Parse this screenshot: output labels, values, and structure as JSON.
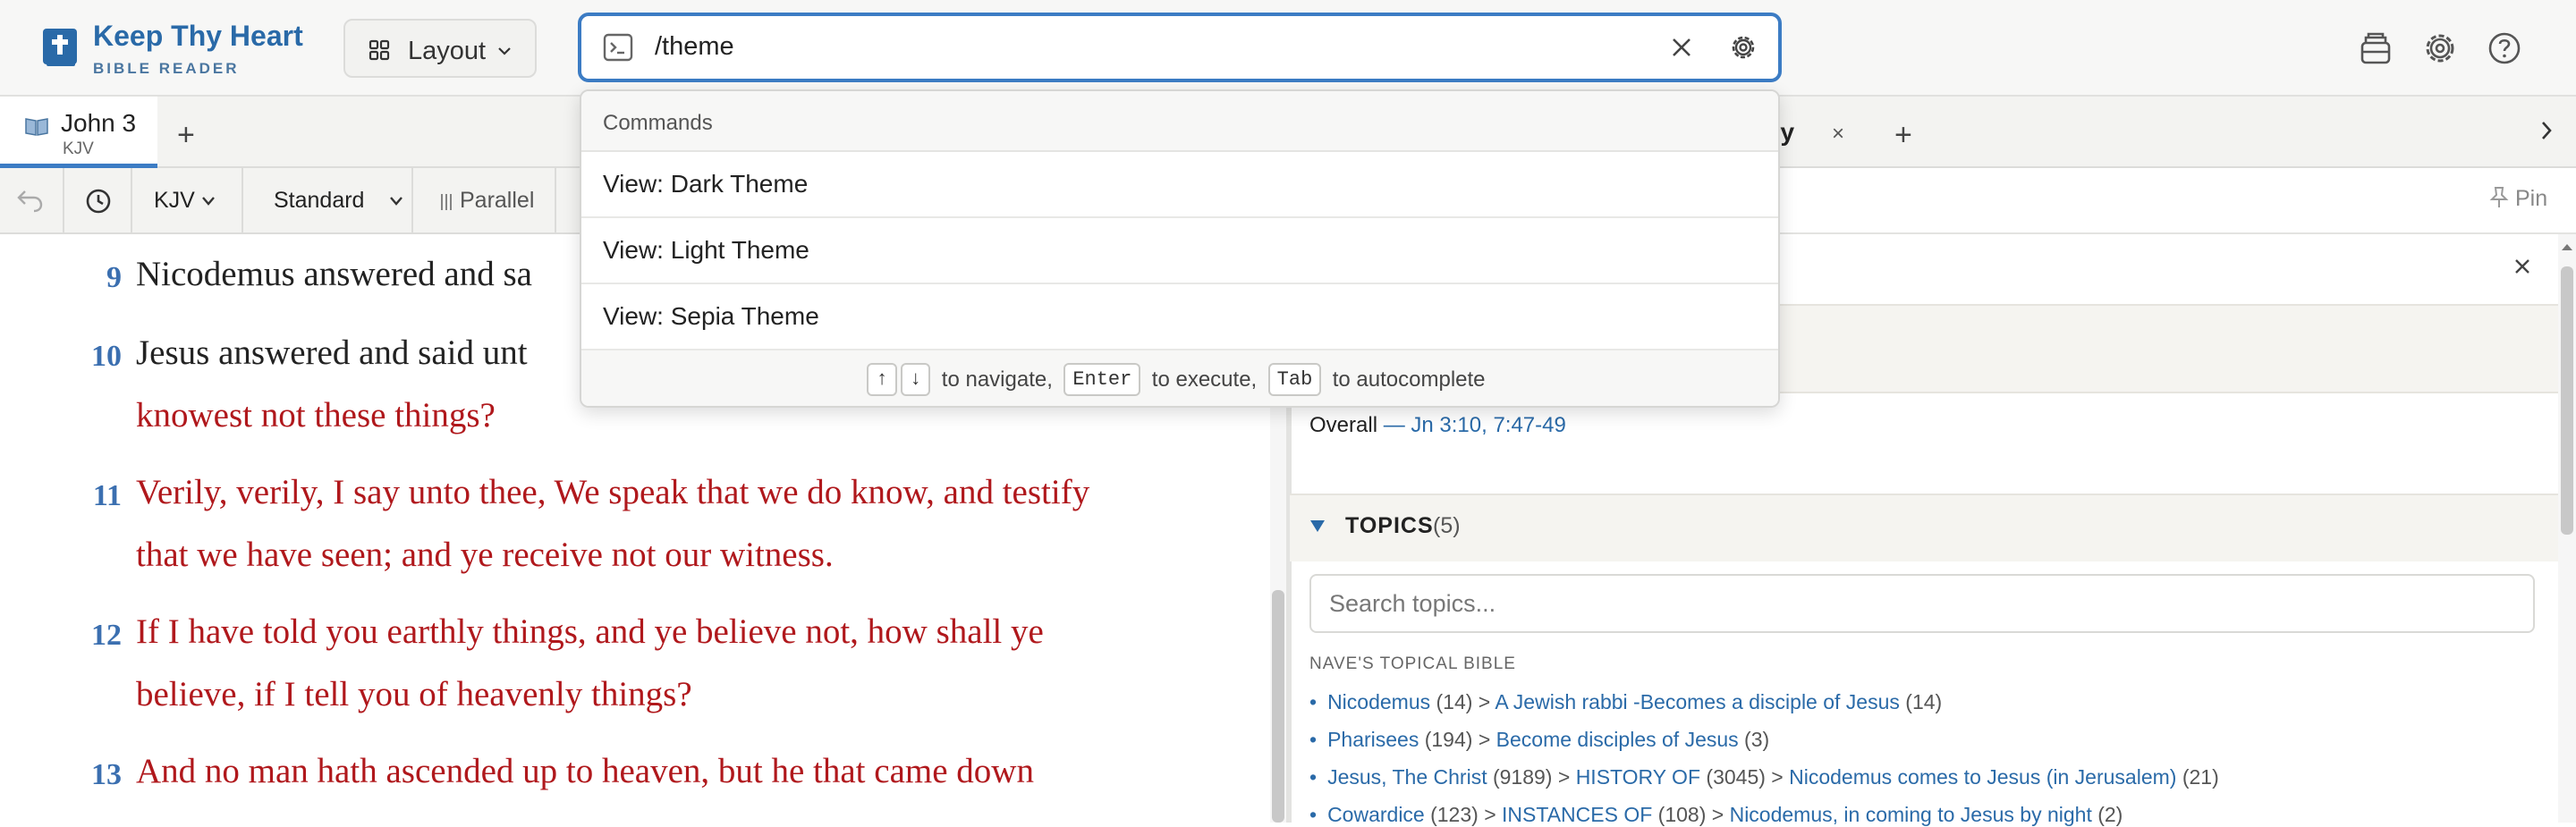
{
  "app": {
    "title": "Keep Thy Heart",
    "subtitle": "BIBLE READER"
  },
  "header": {
    "layout_label": "Layout",
    "command_value": "/theme"
  },
  "tabs": {
    "active": {
      "name": "John 3",
      "version": "KJV"
    },
    "add_label": "+",
    "right_tab_partial": "ary",
    "right_tab_close": "×"
  },
  "toolbar": {
    "version": "KJV",
    "mode": "Standard",
    "parallel": "Parallel",
    "pin": "Pin"
  },
  "bible": {
    "verses": [
      {
        "num": "9",
        "lines": [
          "Nicodemus answered and sa"
        ]
      },
      {
        "num": "10",
        "lines": [
          "Jesus answered and said unt",
          "knowest not these things?"
        ]
      },
      {
        "num": "11",
        "lines": [
          "Verily, verily, I say unto thee, We speak that we do know, and testify",
          "that we have seen; and ye receive not our witness."
        ]
      },
      {
        "num": "12",
        "lines": [
          "If I have told you earthly things, and ye believe not, how shall ye",
          "believe, if I tell you of heavenly things?"
        ]
      },
      {
        "num": "13",
        "lines": [
          "And no man hath ascended up to heaven, but he that came down"
        ]
      }
    ]
  },
  "panel": {
    "overall_label": "Overall",
    "overall_sep": " — ",
    "overall_refs": "Jn 3:10, 7:47-49",
    "topics_label": "TOPICS",
    "topics_count": "(5)",
    "search_placeholder": "Search topics...",
    "source_label": "NAVE'S TOPICAL BIBLE",
    "topics": [
      {
        "parts": [
          {
            "t": "Nicodemus",
            "link": true
          },
          {
            "t": " (14) > ",
            "link": false
          },
          {
            "t": "A Jewish rabbi -Becomes a disciple of Jesus",
            "link": true
          },
          {
            "t": " (14)",
            "link": false
          }
        ]
      },
      {
        "parts": [
          {
            "t": "Pharisees",
            "link": true
          },
          {
            "t": " (194) > ",
            "link": false
          },
          {
            "t": "Become disciples of Jesus",
            "link": true
          },
          {
            "t": " (3)",
            "link": false
          }
        ]
      },
      {
        "parts": [
          {
            "t": "Jesus, The Christ",
            "link": true
          },
          {
            "t": " (9189) > ",
            "link": false
          },
          {
            "t": "HISTORY OF",
            "link": true
          },
          {
            "t": " (3045) > ",
            "link": false
          },
          {
            "t": "Nicodemus comes to Jesus (in Jerusalem)",
            "link": true
          },
          {
            "t": " (21)",
            "link": false
          }
        ]
      },
      {
        "parts": [
          {
            "t": "Cowardice",
            "link": true
          },
          {
            "t": " (123) > ",
            "link": false
          },
          {
            "t": "INSTANCES OF",
            "link": true
          },
          {
            "t": " (108) > ",
            "link": false
          },
          {
            "t": "Nicodemus, in coming to Jesus by night",
            "link": true
          },
          {
            "t": " (2)",
            "link": false
          }
        ]
      }
    ]
  },
  "dropdown": {
    "header": "Commands",
    "items": [
      "View: Dark Theme",
      "View: Light Theme",
      "View: Sepia Theme"
    ],
    "footer": {
      "key_up": "↑",
      "key_down": "↓",
      "navigate": "to navigate,",
      "key_enter": "Enter",
      "execute": "to execute,",
      "key_tab": "Tab",
      "autocomplete": "to autocomplete"
    }
  },
  "colors": {
    "accent": "#3c7cc4",
    "verse_number": "#3b6fb0",
    "words_of_christ": "#b0181c",
    "link": "#2a6aa8"
  },
  "icons": [
    "bible-logo-icon",
    "layout-grid-icon",
    "chevron-down-icon",
    "terminal-icon",
    "clear-icon",
    "settings-icon",
    "library-icon",
    "gear-icon",
    "help-icon",
    "book-icon",
    "undo-icon",
    "history-icon",
    "parallel-icon",
    "pin-icon",
    "close-icon",
    "triangle-down-icon",
    "chevron-right-icon"
  ]
}
